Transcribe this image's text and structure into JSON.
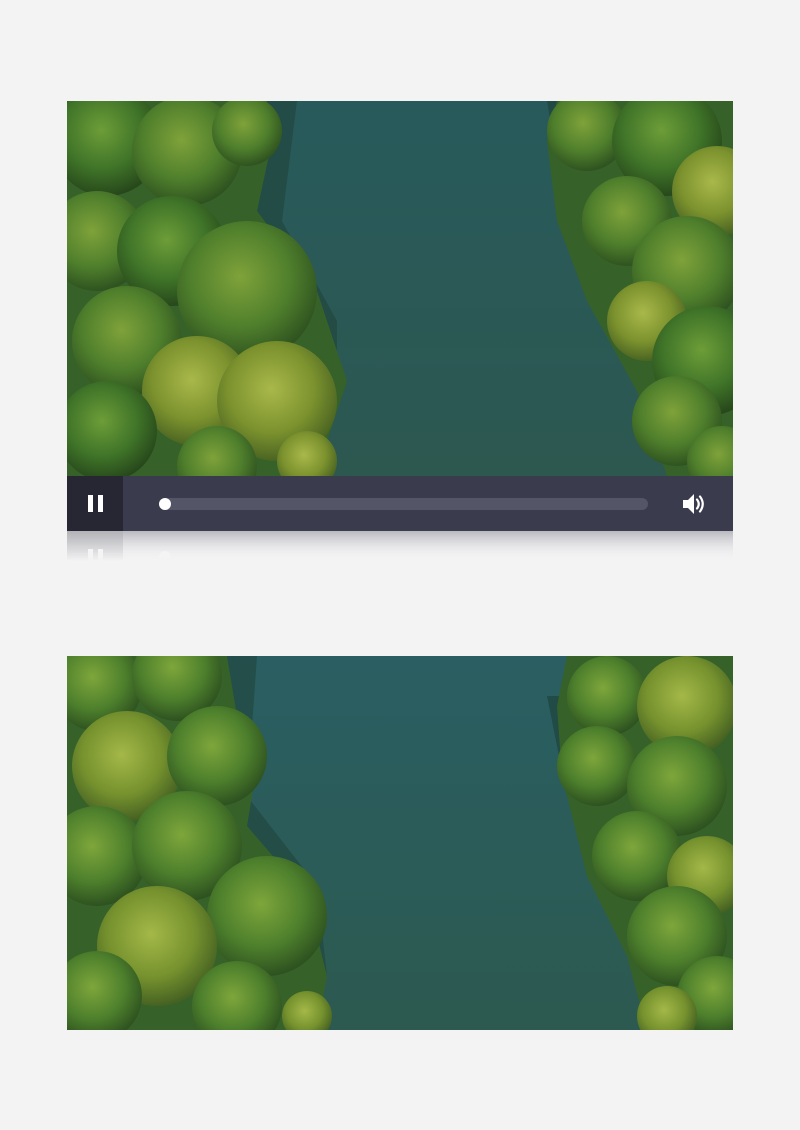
{
  "video": {
    "state": "playing",
    "progress": 0.0
  },
  "controls": {
    "play_pause_icon": "pause-icon",
    "volume_icon": "volume-icon"
  },
  "colors": {
    "page_background": "#f3f3f4",
    "control_bar": "#3a3b4c",
    "play_button_background": "#262733",
    "track": "#545566",
    "knob": "#ffffff",
    "water": "#2e5a54",
    "foliage_dark": "#3f6b25",
    "foliage_light": "#8fae3c"
  }
}
